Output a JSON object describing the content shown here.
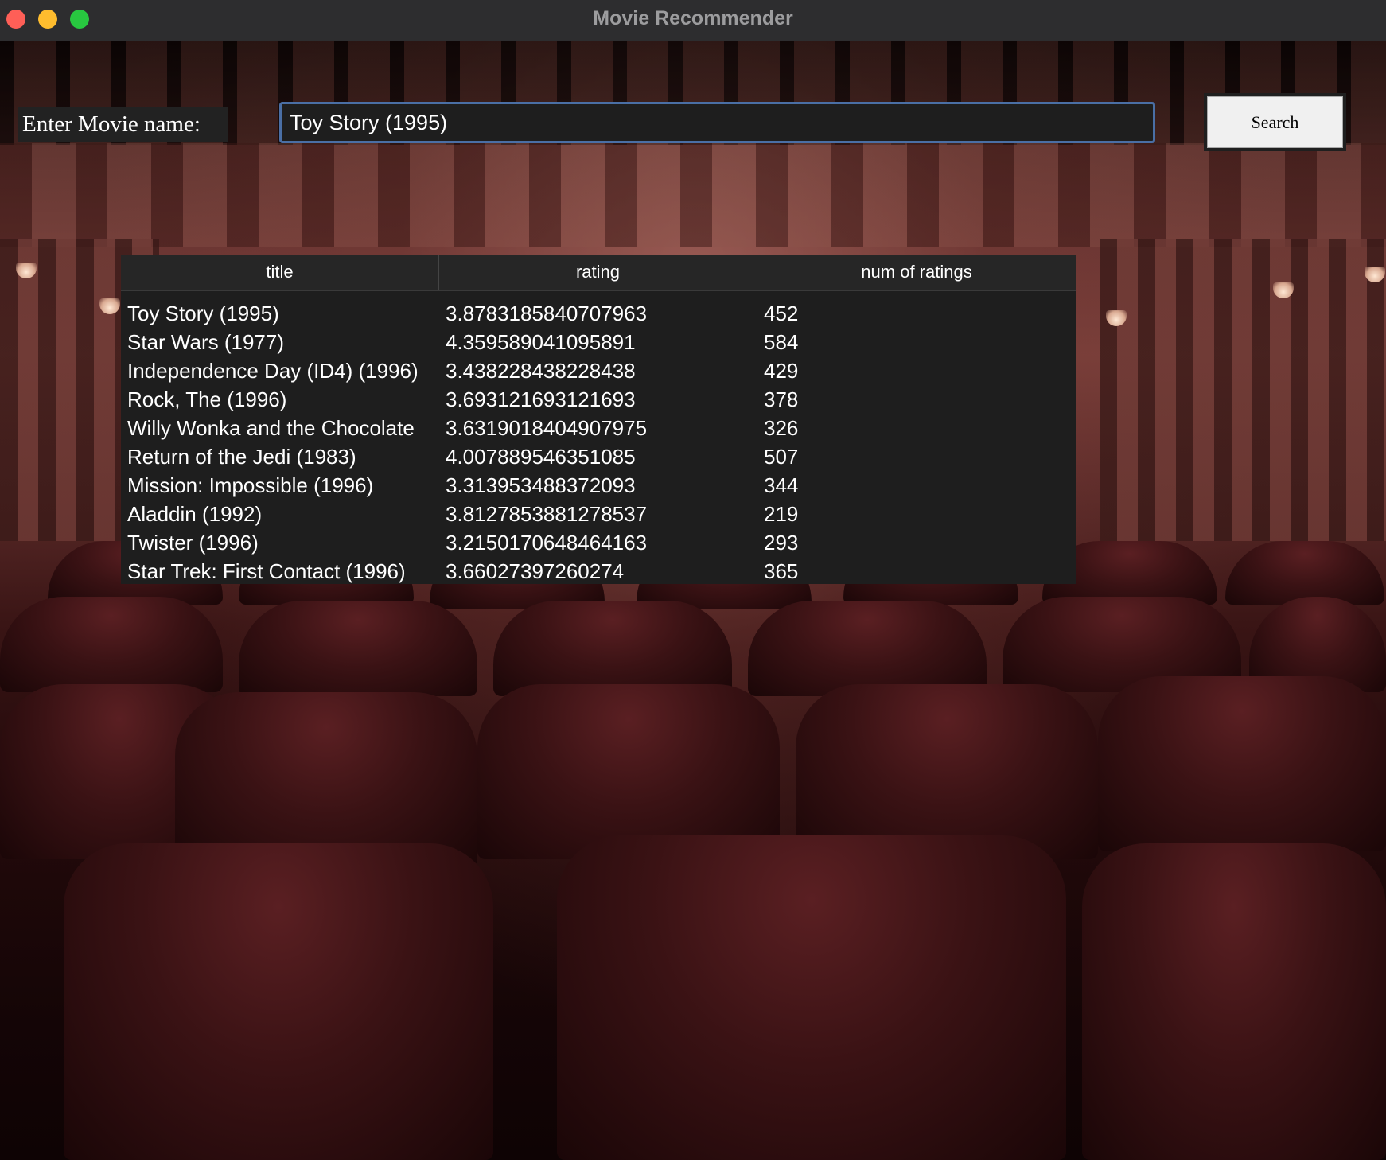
{
  "window": {
    "title": "Movie Recommender"
  },
  "form": {
    "label": "Enter Movie name:",
    "query": "Toy Story (1995)",
    "search_label": "Search"
  },
  "table": {
    "columns": [
      "title",
      "rating",
      "num of ratings"
    ],
    "rows": [
      [
        "Toy Story (1995)",
        "3.8783185840707963",
        "452"
      ],
      [
        "Star Wars (1977)",
        "4.359589041095891",
        "584"
      ],
      [
        "Independence Day (ID4) (1996)",
        "3.438228438228438",
        "429"
      ],
      [
        "Rock, The (1996)",
        "3.693121693121693",
        "378"
      ],
      [
        "Willy Wonka and the Chocolate",
        "3.6319018404907975",
        "326"
      ],
      [
        "Return of the Jedi (1983)",
        "4.007889546351085",
        "507"
      ],
      [
        "Mission: Impossible (1996)",
        "3.313953488372093",
        "344"
      ],
      [
        "Aladdin (1992)",
        "3.8127853881278537",
        "219"
      ],
      [
        "Twister (1996)",
        "3.2150170648464163",
        "293"
      ],
      [
        "Star Trek: First Contact (1996)",
        "3.66027397260274",
        "365"
      ]
    ]
  }
}
